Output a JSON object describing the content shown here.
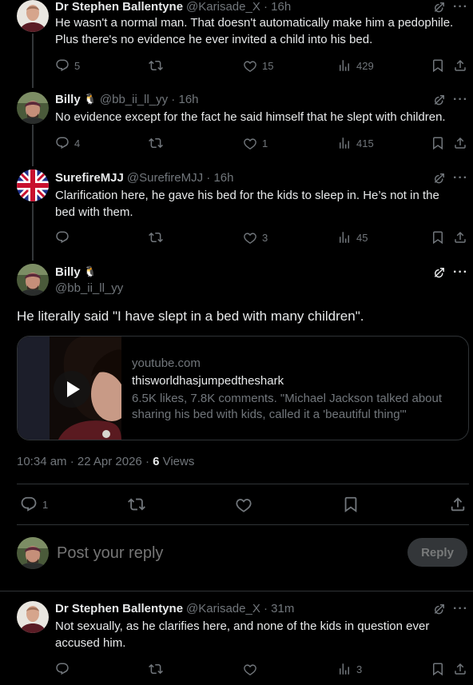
{
  "colors": {
    "background": "#000000",
    "text": "#e7e9ea",
    "muted": "#71767b",
    "divider": "#2f3336",
    "reply_button_bg": "#333639"
  },
  "posts": [
    {
      "name": "Dr Stephen Ballentyne",
      "handle": "@Karisade_X · 16h",
      "text_lines": [
        "He wasn't a normal man.  That doesn't automatically make him a pedophile.",
        "Plus there's no evidence he ever invited a child into his bed."
      ],
      "replies": "5",
      "reposts": "",
      "likes": "15",
      "views": "429"
    },
    {
      "name": "Billy",
      "emoji": "🐧",
      "handle": "@bb_ii_ll_yy · 16h",
      "text_lines": [
        "No evidence except for the fact he said himself that he slept with children."
      ],
      "replies": "4",
      "reposts": "",
      "likes": "1",
      "views": "415"
    },
    {
      "name": "SurefireMJJ",
      "handle": "@SurefireMJJ · 16h",
      "text_lines": [
        "Clarification here, he gave his bed for the kids to sleep in. He’s not in the",
        "bed with them."
      ],
      "replies": "",
      "reposts": "",
      "likes": "3",
      "views": "45"
    }
  ],
  "main_post": {
    "name": "Billy",
    "emoji": "🐧",
    "handle": "@bb_ii_ll_yy",
    "text": "He literally said \"I have slept in a bed with many children\".",
    "card": {
      "domain": "youtube.com",
      "title": "thisworldhasjumpedtheshark",
      "desc_lines": [
        "6.5K likes, 7.8K comments. \"Michael Jackson talked about",
        "sharing his bed with kids, called it a 'beautiful thing'\""
      ]
    },
    "timestamp": "10:34 am · 22 Apr 2026 · ",
    "views_count": "6",
    "views_label": " Views",
    "replies": "1"
  },
  "composer": {
    "placeholder": "Post your reply",
    "button": "Reply"
  },
  "reply_post": {
    "name": "Dr Stephen Ballentyne",
    "handle": "@Karisade_X · 31m",
    "text_lines": [
      "Not sexually, as he clarifies here, and none of the kids in question ever",
      "accused him."
    ],
    "views": "3"
  },
  "icons": [
    "reply-icon",
    "repost-icon",
    "like-icon",
    "views-icon",
    "bookmark-icon",
    "share-icon",
    "grok-icon",
    "more-icon",
    "play-icon"
  ]
}
